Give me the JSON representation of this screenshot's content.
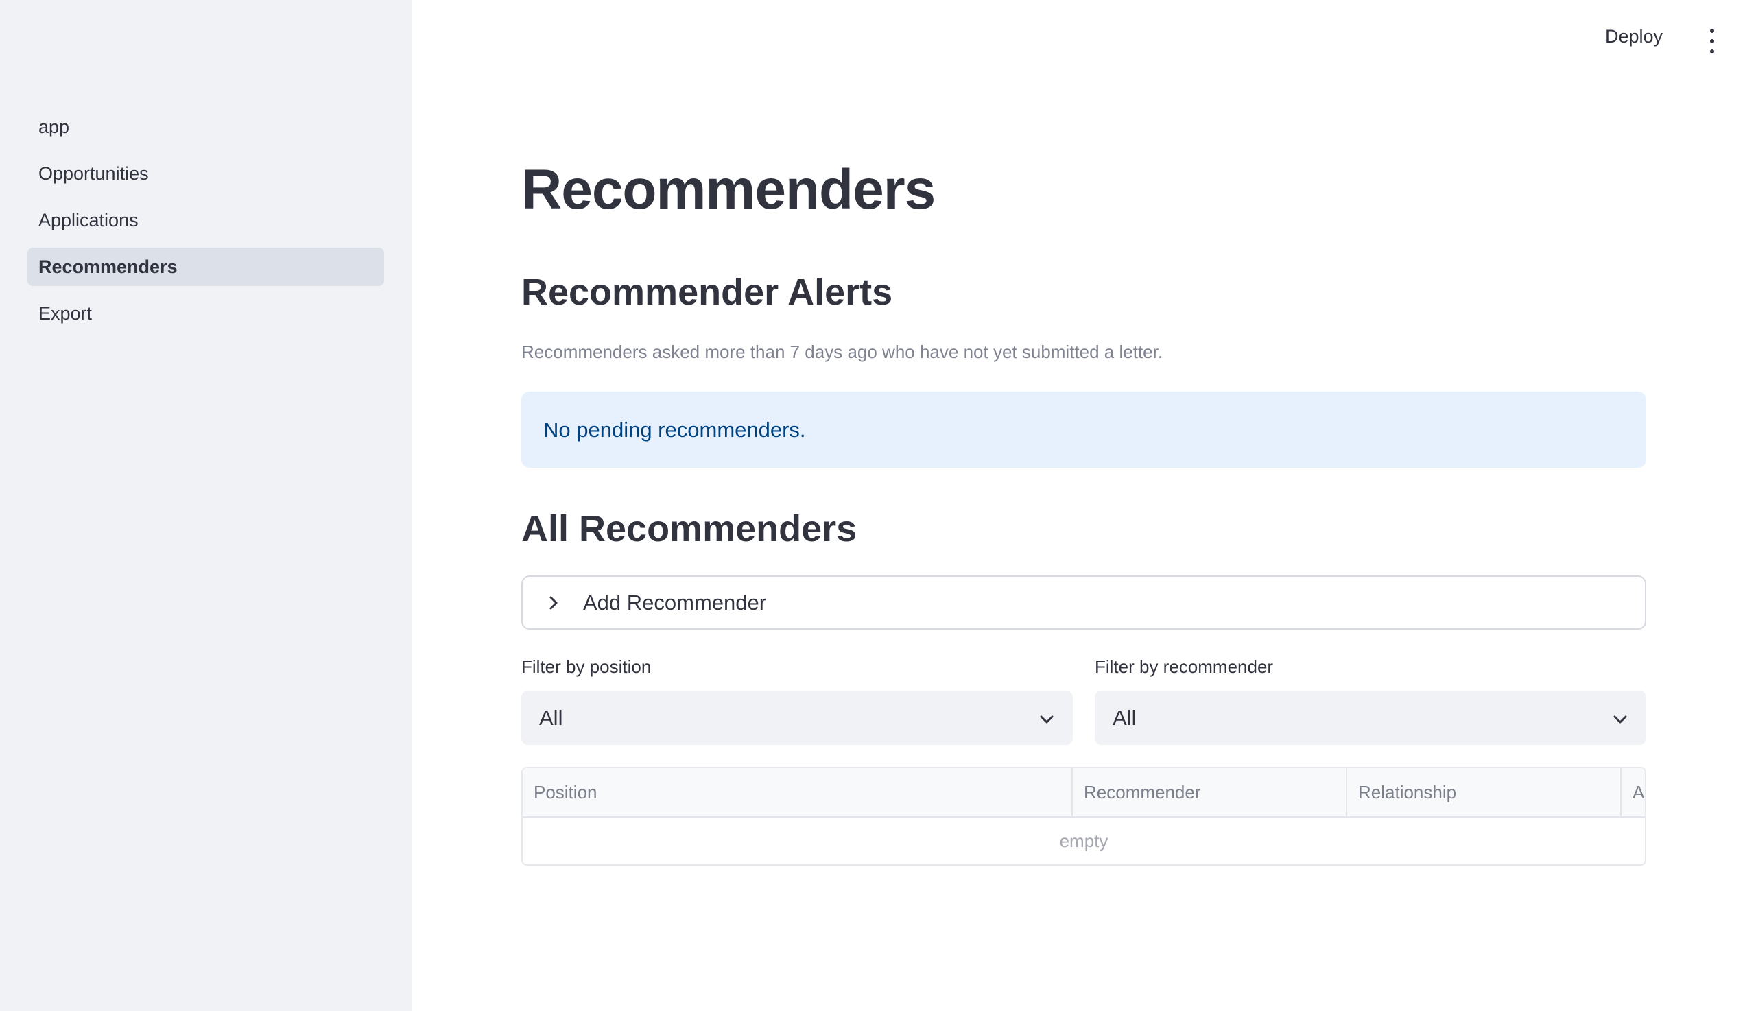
{
  "sidebar": {
    "items": [
      {
        "label": "app"
      },
      {
        "label": "Opportunities"
      },
      {
        "label": "Applications"
      },
      {
        "label": "Recommenders",
        "active": true
      },
      {
        "label": "Export"
      }
    ]
  },
  "header": {
    "deploy_label": "Deploy",
    "menu_icon": "vertical-ellipsis-icon"
  },
  "main": {
    "title": "Recommenders",
    "alerts_section": {
      "title": "Recommender Alerts",
      "caption": "Recommenders asked more than 7 days ago who have not yet submitted a letter.",
      "info_message": "No pending recommenders."
    },
    "all_section": {
      "title": "All Recommenders",
      "expander_label": "Add Recommender",
      "filters": [
        {
          "label": "Filter by position",
          "value": "All"
        },
        {
          "label": "Filter by recommender",
          "value": "All"
        }
      ],
      "table": {
        "columns": [
          "Position",
          "Recommender",
          "Relationship",
          "As"
        ],
        "empty_text": "empty"
      }
    }
  },
  "colors": {
    "sidebar_bg": "#f0f2f6",
    "active_nav_bg": "#dbe0e9",
    "info_bg": "#e6f1fd",
    "info_text": "#004280",
    "text": "#31333f"
  }
}
